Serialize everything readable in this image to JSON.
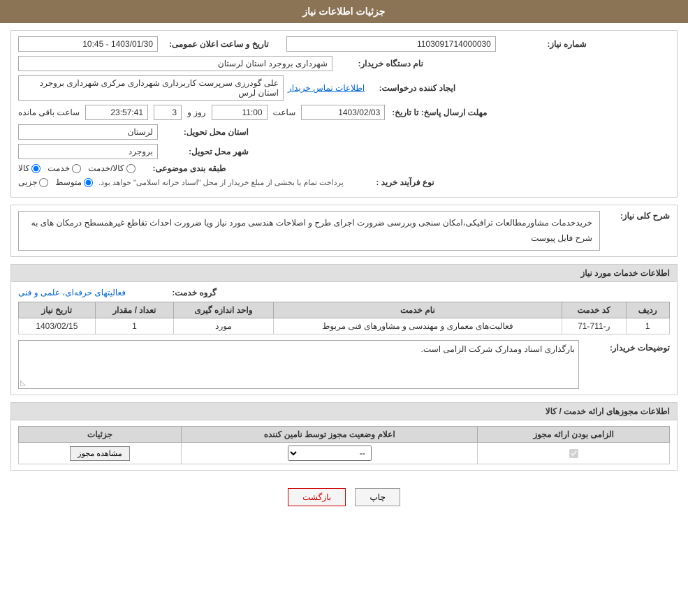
{
  "header": {
    "title": "جزئیات اطلاعات نیاز"
  },
  "fields": {
    "need_number_label": "شماره نیاز:",
    "need_number_value": "1103091714000030",
    "buyer_org_label": "نام دستگاه خریدار:",
    "buyer_org_value": "شهرداری بروجرد استان لرستان",
    "requester_label": "ایجاد کننده درخواست:",
    "requester_value": "علی گودرزی سرپرست کاربرداری شهرداری مرکزی شهرداری بروجرد استان لرس",
    "requester_link": "اطلاعات تماس خریدار",
    "reply_deadline_label": "مهلت ارسال پاسخ: تا تاریخ:",
    "reply_date": "1403/02/03",
    "reply_time_label": "ساعت",
    "reply_time": "11:00",
    "reply_days_label": "روز و",
    "reply_days": "3",
    "reply_remaining_label": "ساعت باقی مانده",
    "reply_remaining": "23:57:41",
    "delivery_province_label": "استان محل تحویل:",
    "delivery_province": "لرستان",
    "delivery_city_label": "شهر محل تحویل:",
    "delivery_city": "بروجرد",
    "category_label": "طبقه بندی موضوعی:",
    "category_options": [
      "کالا",
      "خدمت",
      "کالا/خدمت"
    ],
    "category_selected": "کالا",
    "purchase_type_label": "نوع فرآیند خرید :",
    "purchase_type_options": [
      "جزیی",
      "متوسط"
    ],
    "purchase_type_selected": "متوسط",
    "purchase_type_note": "پرداخت تمام یا بخشی از مبلغ خریدار از محل \"اسناد خزانه اسلامی\" خواهد بود.",
    "announcement_label": "تاریخ و ساعت اعلان عمومی:",
    "announcement_value": "1403/01/30 - 10:45",
    "description_section_label": "شرح کلی نیاز:",
    "description_text": "خریدخدمات مشاورمطالعات ترافیکی،امکان سنجی وبررسی ضرورت اجرای طرح و اصلاحات هندسی مورد نیاز\nویا ضرورت احداث تقاطع غیرهمسطح درمکان های به شرح فایل پیوست"
  },
  "services_section": {
    "title": "اطلاعات خدمات مورد نیاز",
    "service_group_label": "گروه خدمت:",
    "service_group_value": "فعالیتهای حرفه‌ای، علمی و فنی",
    "table_headers": [
      "ردیف",
      "کد خدمت",
      "نام خدمت",
      "واحد اندازه گیری",
      "تعداد / مقدار",
      "تاریخ نیاز"
    ],
    "table_rows": [
      {
        "row": "1",
        "code": "ر-711-71",
        "name": "فعالیت‌های معماری و مهندسی و مشاورهای فنی مربوط",
        "unit": "مورد",
        "quantity": "1",
        "date": "1403/02/15"
      }
    ]
  },
  "buyer_notes_section": {
    "label": "توضیحات خریدار:",
    "text": "بارگذاری اسناد ومدارک شرکت الزامی است."
  },
  "license_section": {
    "title": "اطلاعات مجوزهای ارائه خدمت / کالا",
    "table_headers": [
      "الزامی بودن ارائه مجوز",
      "اعلام وضعیت مجوز توسط نامین کننده",
      "جزئیات"
    ],
    "table_rows": [
      {
        "required": true,
        "status": "--",
        "details_btn": "مشاهده مجوز"
      }
    ]
  },
  "buttons": {
    "print": "چاپ",
    "back": "بازگشت"
  }
}
